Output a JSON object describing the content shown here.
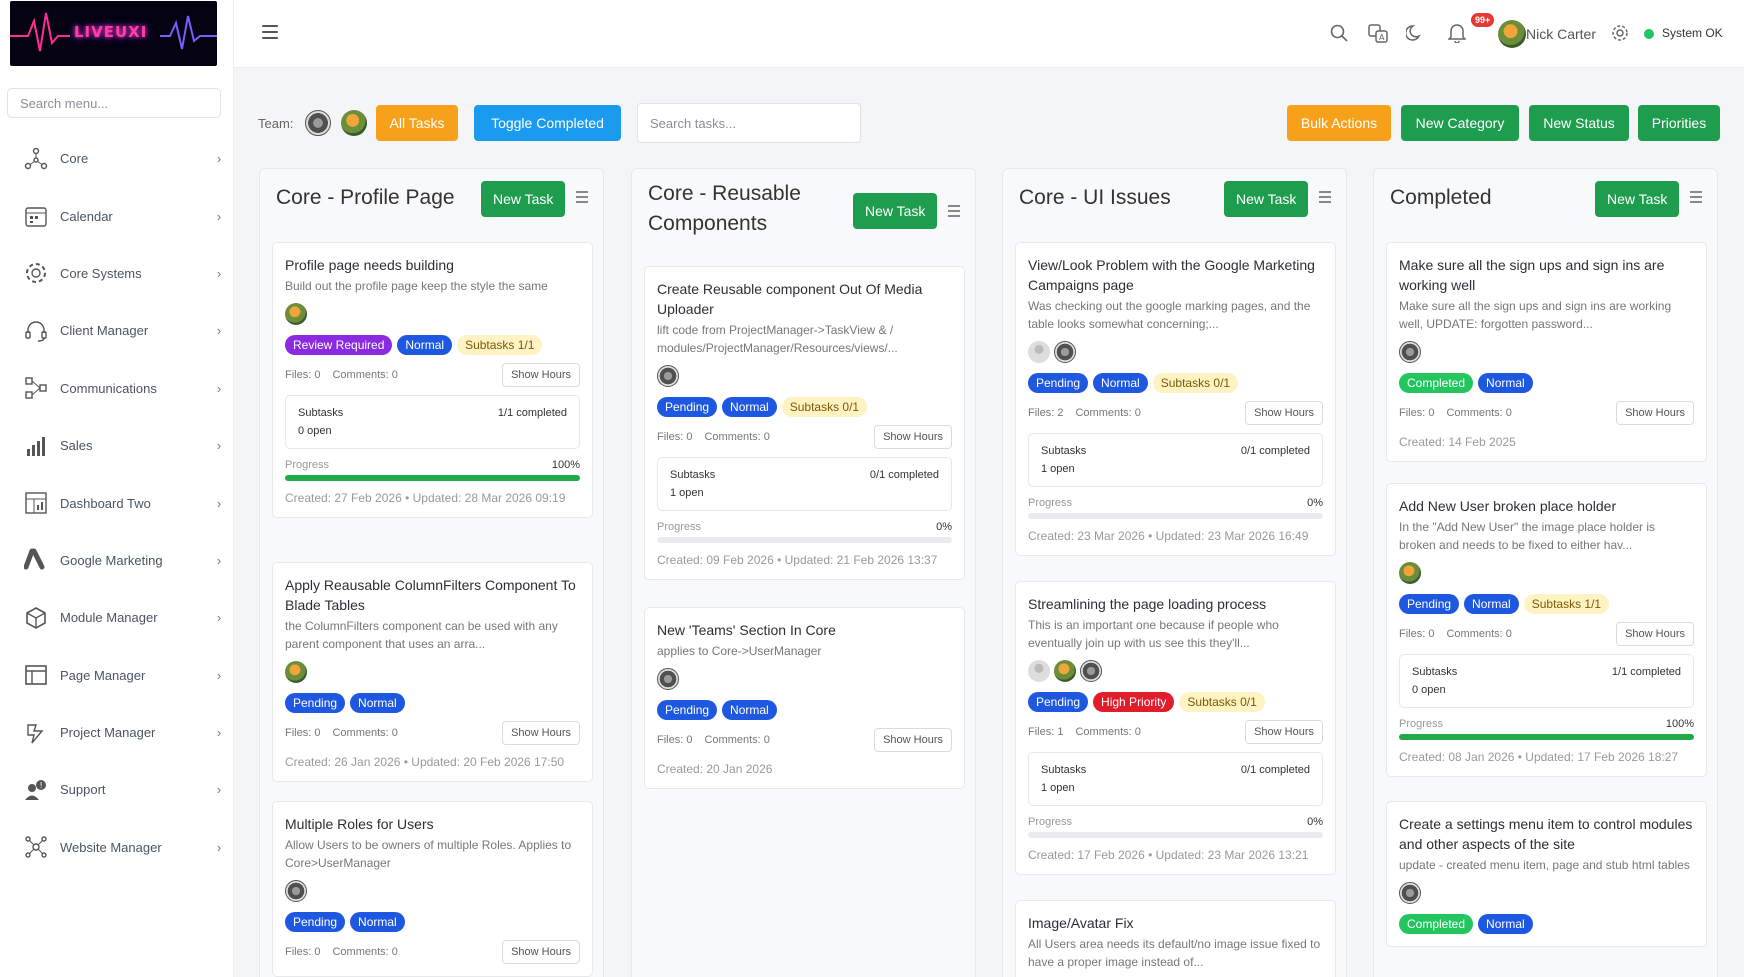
{
  "app": {
    "logo_text": "LIVEUXI"
  },
  "sidebar": {
    "search_placeholder": "Search menu...",
    "items": [
      {
        "label": "Core",
        "icon": "network-icon"
      },
      {
        "label": "Calendar",
        "icon": "calendar-icon"
      },
      {
        "label": "Core Systems",
        "icon": "gear-system-icon"
      },
      {
        "label": "Client Manager",
        "icon": "headset-icon"
      },
      {
        "label": "Communications",
        "icon": "communications-icon"
      },
      {
        "label": "Sales",
        "icon": "sales-chart-icon"
      },
      {
        "label": "Dashboard Two",
        "icon": "dashboard-icon"
      },
      {
        "label": "Google Marketing",
        "icon": "google-ads-icon"
      },
      {
        "label": "Module Manager",
        "icon": "cube-icon"
      },
      {
        "label": "Page Manager",
        "icon": "page-layout-icon"
      },
      {
        "label": "Project Manager",
        "icon": "project-icon"
      },
      {
        "label": "Support",
        "icon": "support-icon"
      },
      {
        "label": "Website Manager",
        "icon": "website-network-icon"
      }
    ]
  },
  "topbar": {
    "notifications_badge": "99+",
    "user_name": "Nick Carter",
    "system_status": "System OK",
    "status_color": "#22c55e"
  },
  "toolbar": {
    "team_label": "Team:",
    "all_tasks": "All Tasks",
    "toggle_completed": "Toggle Completed",
    "search_placeholder": "Search tasks...",
    "bulk_actions": "Bulk Actions",
    "new_category": "New Category",
    "new_status": "New Status",
    "priorities": "Priorities"
  },
  "columns": [
    {
      "title": "Core - Profile Page",
      "new_task": "New Task",
      "cards": [
        {
          "title": "Profile page needs building",
          "desc": "Build out the profile page keep the style the same",
          "avatars": [
            "tiger"
          ],
          "tags": [
            {
              "text": "Review Required",
              "kind": "purple"
            },
            {
              "text": "Normal",
              "kind": "blue"
            },
            {
              "text": "Subtasks 1/1",
              "kind": "yellow"
            }
          ],
          "files": "Files: 0",
          "comments": "Comments: 0",
          "show_hours": "Show Hours",
          "subtasks": {
            "label": "Subtasks",
            "completed": "1/1 completed",
            "open": "0 open"
          },
          "progress": {
            "label": "Progress",
            "pct": "100%",
            "value": 100
          },
          "created": "Created: 27 Feb 2026  •  Updated: 28 Mar 2026 09:19"
        },
        {
          "title": "Apply Reausable ColumnFilters Component To Blade Tables",
          "desc": "the ColumnFilters component can be used with any parent component that uses an arra...",
          "avatars": [
            "tiger"
          ],
          "tags": [
            {
              "text": "Pending",
              "kind": "blue"
            },
            {
              "text": "Normal",
              "kind": "blue"
            }
          ],
          "files": "Files: 0",
          "comments": "Comments: 0",
          "show_hours": "Show Hours",
          "created": "Created: 26 Jan 2026  •  Updated: 20 Feb 2026 17:50"
        },
        {
          "title": "Multiple Roles for Users",
          "desc": "Allow Users to be owners of multiple Roles. Applies to Core>UserManager",
          "avatars": [
            "owl"
          ],
          "tags": [
            {
              "text": "Pending",
              "kind": "blue"
            },
            {
              "text": "Normal",
              "kind": "blue"
            }
          ],
          "files": "Files: 0",
          "comments": "Comments: 0",
          "show_hours": "Show Hours"
        }
      ]
    },
    {
      "title": "Core - Reusable Components",
      "new_task": "New Task",
      "cards": [
        {
          "title": "Create Reusable component Out Of Media Uploader",
          "desc": "lift code from ProjectManager->TaskView & / modules/ProjectManager/Resources/views/...",
          "avatars": [
            "owl"
          ],
          "tags": [
            {
              "text": "Pending",
              "kind": "blue"
            },
            {
              "text": "Normal",
              "kind": "blue"
            },
            {
              "text": "Subtasks 0/1",
              "kind": "yellow"
            }
          ],
          "files": "Files: 0",
          "comments": "Comments: 0",
          "show_hours": "Show Hours",
          "subtasks": {
            "label": "Subtasks",
            "completed": "0/1 completed",
            "open": "1 open"
          },
          "progress": {
            "label": "Progress",
            "pct": "0%",
            "value": 0
          },
          "created": "Created: 09 Feb 2026  •  Updated: 21 Feb 2026 13:37"
        },
        {
          "title": "New 'Teams' Section In Core",
          "desc": "applies to Core->UserManager",
          "avatars": [
            "owl"
          ],
          "tags": [
            {
              "text": "Pending",
              "kind": "blue"
            },
            {
              "text": "Normal",
              "kind": "blue"
            }
          ],
          "files": "Files: 0",
          "comments": "Comments: 0",
          "show_hours": "Show Hours",
          "created": "Created: 20 Jan 2026"
        }
      ]
    },
    {
      "title": "Core - UI Issues",
      "new_task": "New Task",
      "cards": [
        {
          "title": "View/Look Problem with the Google Marketing Campaigns page",
          "desc": "Was checking out the google marking pages, and the table looks somewhat concerning;...",
          "avatars": [
            "person",
            "owl"
          ],
          "tags": [
            {
              "text": "Pending",
              "kind": "blue"
            },
            {
              "text": "Normal",
              "kind": "blue"
            },
            {
              "text": "Subtasks 0/1",
              "kind": "yellow"
            }
          ],
          "files": "Files: 2",
          "comments": "Comments: 0",
          "show_hours": "Show Hours",
          "subtasks": {
            "label": "Subtasks",
            "completed": "0/1 completed",
            "open": "1 open"
          },
          "progress": {
            "label": "Progress",
            "pct": "0%",
            "value": 0
          },
          "created": "Created: 23 Mar 2026  •  Updated: 23 Mar 2026 16:49"
        },
        {
          "title": "Streamlining the page loading process",
          "desc": "This is an important one because if people who eventually join up with us see this they'll...",
          "avatars": [
            "person",
            "tiger",
            "owl"
          ],
          "tags": [
            {
              "text": "Pending",
              "kind": "blue"
            },
            {
              "text": "High Priority",
              "kind": "red"
            },
            {
              "text": "Subtasks 0/1",
              "kind": "yellow"
            }
          ],
          "files": "Files: 1",
          "comments": "Comments: 0",
          "show_hours": "Show Hours",
          "subtasks": {
            "label": "Subtasks",
            "completed": "0/1 completed",
            "open": "1 open"
          },
          "progress": {
            "label": "Progress",
            "pct": "0%",
            "value": 0
          },
          "created": "Created: 17 Feb 2026  •  Updated: 23 Mar 2026 13:21"
        },
        {
          "title": "Image/Avatar Fix",
          "desc": "All Users area needs its default/no image issue fixed to have a proper image instead of...",
          "avatars": [],
          "tags": []
        }
      ]
    },
    {
      "title": "Completed",
      "new_task": "New Task",
      "cards": [
        {
          "title": "Make sure all the sign ups and sign ins are working well",
          "desc": "Make sure all the sign ups and sign ins are working well, UPDATE: forgotten password...",
          "avatars": [
            "owl"
          ],
          "tags": [
            {
              "text": "Completed",
              "kind": "green"
            },
            {
              "text": "Normal",
              "kind": "blue"
            }
          ],
          "files": "Files: 0",
          "comments": "Comments: 0",
          "show_hours": "Show Hours",
          "created": "Created: 14 Feb 2025"
        },
        {
          "title": "Add New User broken place holder",
          "desc": "In the \"Add New User\" the image place holder is broken and needs to be fixed to either hav...",
          "avatars": [
            "tiger"
          ],
          "tags": [
            {
              "text": "Pending",
              "kind": "blue"
            },
            {
              "text": "Normal",
              "kind": "blue"
            },
            {
              "text": "Subtasks 1/1",
              "kind": "yellow"
            }
          ],
          "files": "Files: 0",
          "comments": "Comments: 0",
          "show_hours": "Show Hours",
          "subtasks": {
            "label": "Subtasks",
            "completed": "1/1 completed",
            "open": "0 open"
          },
          "progress": {
            "label": "Progress",
            "pct": "100%",
            "value": 100
          },
          "created": "Created: 08 Jan 2026  •  Updated: 17 Feb 2026 18:27"
        },
        {
          "title": "Create a settings menu item to control modules and other aspects of the site",
          "desc": "update - created menu item, page and stub html tables",
          "avatars": [
            "owl"
          ],
          "tags": [
            {
              "text": "Completed",
              "kind": "green"
            },
            {
              "text": "Normal",
              "kind": "blue"
            }
          ]
        }
      ]
    }
  ]
}
